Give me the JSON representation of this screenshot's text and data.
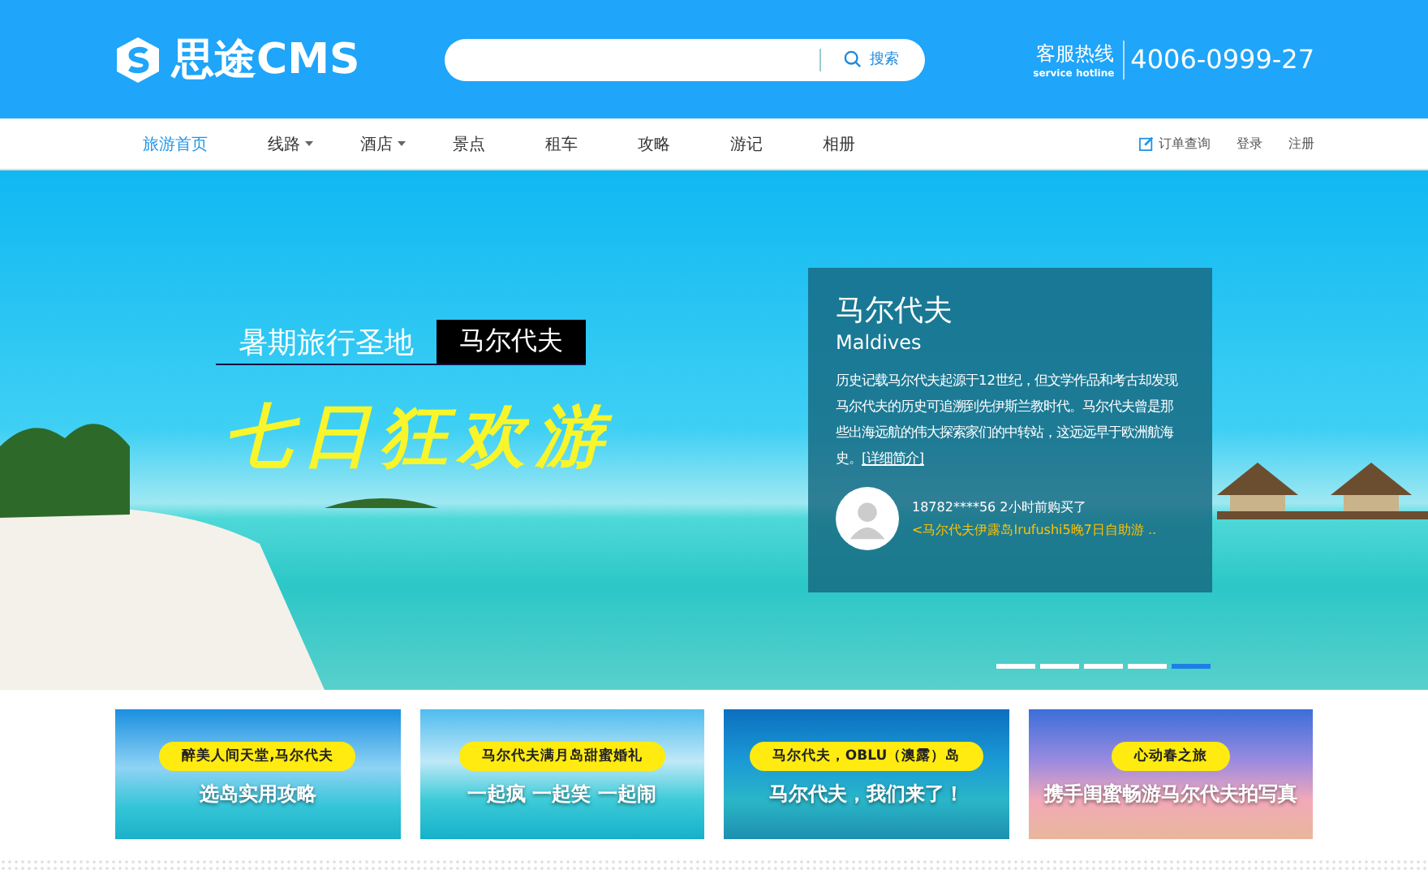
{
  "header": {
    "logo_text": "思途CMS",
    "search": {
      "button": "搜索"
    },
    "hotline": {
      "label": "客服热线",
      "sublabel": "service hotline",
      "number": "4006-0999-27"
    }
  },
  "nav": {
    "items": [
      {
        "label": "旅游首页",
        "selected": true,
        "dropdown": false
      },
      {
        "label": "线路",
        "selected": false,
        "dropdown": true
      },
      {
        "label": "酒店",
        "selected": false,
        "dropdown": true
      },
      {
        "label": "景点",
        "selected": false,
        "dropdown": false
      },
      {
        "label": "租车",
        "selected": false,
        "dropdown": false
      },
      {
        "label": "攻略",
        "selected": false,
        "dropdown": false
      },
      {
        "label": "游记",
        "selected": false,
        "dropdown": false
      },
      {
        "label": "相册",
        "selected": false,
        "dropdown": false
      }
    ],
    "links": [
      {
        "label": "订单查询",
        "kind": "order"
      },
      {
        "label": "登录",
        "kind": "plain"
      },
      {
        "label": "注册",
        "kind": "plain"
      }
    ]
  },
  "banner": {
    "tagline": "暑期旅行圣地",
    "tag": "马尔代夫",
    "headline": "七日狂欢游",
    "info": {
      "title": "马尔代夫",
      "subtitle": "Maldives",
      "description": "历史记载马尔代夫起源于12世纪，但文学作品和考古却发现马尔代夫的历史可追溯到先伊斯兰教时代。马尔代夫曾是那些出海远航的伟大探索家们的中转站，这远远早于欧洲航海史。",
      "more": "[详细简介]",
      "purchase": "18782****56 2小时前购买了",
      "product": "<马尔代夫伊露岛Irufushi5晚7日自助游 .."
    },
    "slides": [
      {
        "selected": false
      },
      {
        "selected": false
      },
      {
        "selected": false
      },
      {
        "selected": false
      },
      {
        "selected": true
      }
    ]
  },
  "promos": [
    {
      "badge": "醉美人间天堂,马尔代夫",
      "caption": "选岛实用攻略"
    },
    {
      "badge": "马尔代夫满月岛甜蜜婚礼",
      "caption": "一起疯 一起笑 一起闹"
    },
    {
      "badge": "马尔代夫，OBLU（澳露）岛",
      "caption": "马尔代夫，我们来了！"
    },
    {
      "badge": "心动春之旅",
      "caption": "携手闺蜜畅游马尔代夫拍写真"
    }
  ]
}
